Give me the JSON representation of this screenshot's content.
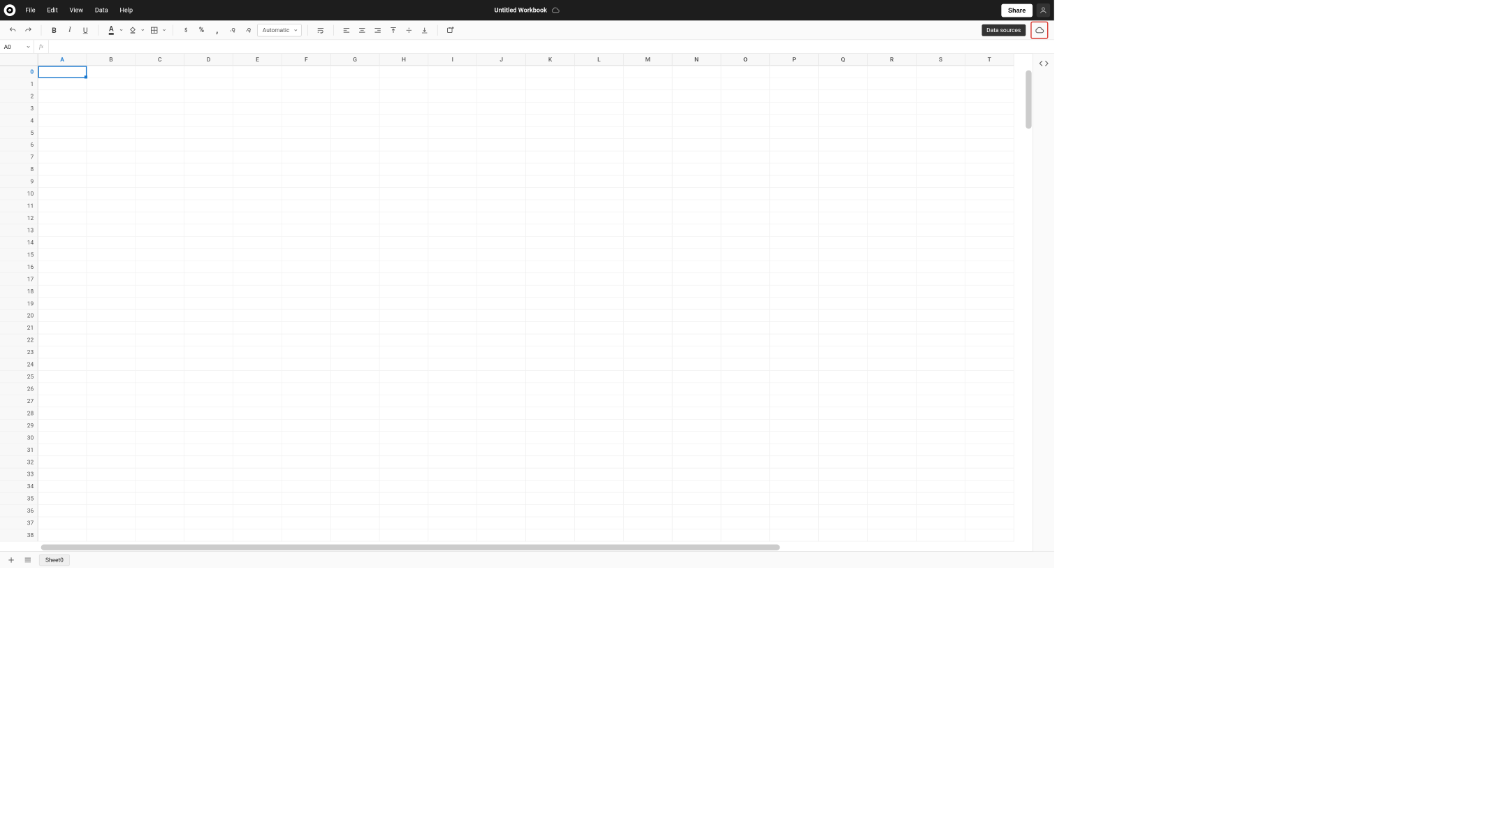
{
  "header": {
    "menus": [
      "File",
      "Edit",
      "View",
      "Data",
      "Help"
    ],
    "title": "Untitled Workbook",
    "share_label": "Share"
  },
  "toolbar": {
    "format_select": "Automatic",
    "tooltip_data_sources": "Data sources"
  },
  "formula_bar": {
    "cell_ref": "A0",
    "fx_label": "fx",
    "formula_value": ""
  },
  "grid": {
    "columns": [
      "A",
      "B",
      "C",
      "D",
      "E",
      "F",
      "G",
      "H",
      "I",
      "J",
      "K",
      "L",
      "M",
      "N",
      "O",
      "P",
      "Q",
      "R",
      "S",
      "T"
    ],
    "row_start": 0,
    "row_end": 38,
    "selected": {
      "col": "A",
      "row": 0
    }
  },
  "sheet_bar": {
    "active_tab": "Sheet0"
  }
}
